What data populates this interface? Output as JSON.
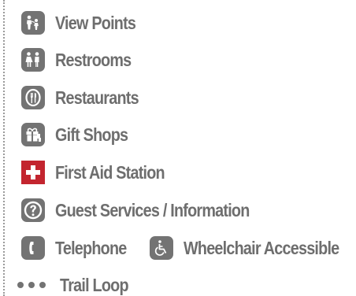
{
  "legend": {
    "items": [
      {
        "label": "View Points",
        "icon": "view-points-icon"
      },
      {
        "label": "Restrooms",
        "icon": "restrooms-icon"
      },
      {
        "label": "Restaurants",
        "icon": "restaurant-icon"
      },
      {
        "label": "Gift Shops",
        "icon": "gift-shop-icon"
      },
      {
        "label": "First Aid Station",
        "icon": "first-aid-icon"
      },
      {
        "label": "Guest Services / Information",
        "icon": "question-icon"
      },
      {
        "label": "Telephone",
        "icon": "telephone-icon"
      },
      {
        "label": "Wheelchair Accessible",
        "icon": "wheelchair-icon"
      },
      {
        "label": "Trail Loop",
        "icon": "trail-dots-icon"
      }
    ]
  },
  "colors": {
    "icon_gray": "#737373",
    "text_gray": "#6e6e6e",
    "first_aid_red": "#c3252f"
  }
}
